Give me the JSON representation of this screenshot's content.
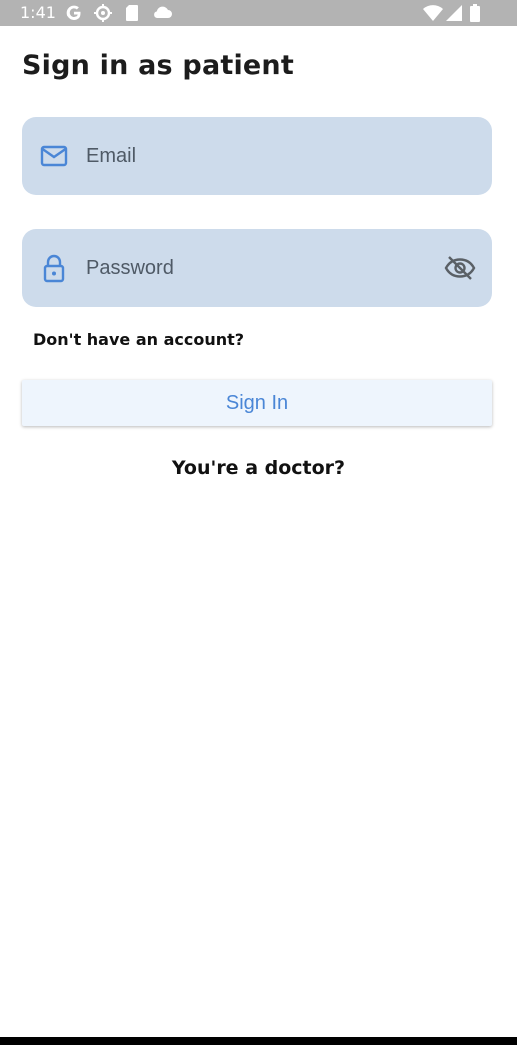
{
  "status_bar": {
    "time": "1:41",
    "icons": [
      "google-icon",
      "settings-icon",
      "sd-card-icon",
      "cloud-icon",
      "wifi-icon",
      "signal-icon",
      "battery-icon"
    ]
  },
  "page": {
    "title": "Sign in as patient"
  },
  "form": {
    "email": {
      "placeholder": "Email",
      "value": "",
      "icon": "mail-icon"
    },
    "password": {
      "placeholder": "Password",
      "value": "",
      "icon": "lock-icon",
      "toggle_icon": "eye-off-icon"
    },
    "signup_link": "Don't have an account?",
    "submit_label": "Sign In",
    "doctor_link": "You're a doctor?"
  },
  "colors": {
    "status_bar_bg": "#b3b3b3",
    "field_bg": "#cddbeb",
    "accent": "#4a86d6",
    "button_bg": "#eef5fd",
    "text": "#111111"
  }
}
